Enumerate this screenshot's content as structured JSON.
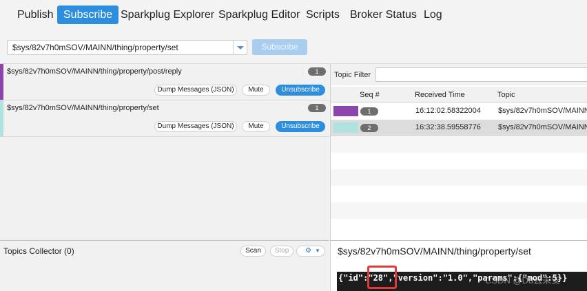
{
  "nav": {
    "items": [
      {
        "label": "Publish",
        "active": false
      },
      {
        "label": "Subscribe",
        "active": true
      },
      {
        "label": "Sparkplug Explorer",
        "active": false
      },
      {
        "label": "Sparkplug Editor",
        "active": false
      },
      {
        "label": "Scripts",
        "active": false
      },
      {
        "label": "Broker Status",
        "active": false
      },
      {
        "label": "Log",
        "active": false
      }
    ]
  },
  "subscribe_bar": {
    "topic_value": "$sys/82v7h0mSOV/MAINN/thing/property/set",
    "subscribe_label": "Subscribe"
  },
  "subscriptions": [
    {
      "topic": "$sys/82v7h0mSOV/MAINN/thing/property/post/reply",
      "count": "1",
      "color": "#8e44ad",
      "dump_label": "Dump Messages (JSON)",
      "mute_label": "Mute",
      "unsubscribe_label": "Unsubscribe"
    },
    {
      "topic": "$sys/82v7h0mSOV/MAINN/thing/property/set",
      "count": "1",
      "color": "#aee3df",
      "dump_label": "Dump Messages (JSON)",
      "mute_label": "Mute",
      "unsubscribe_label": "Unsubscribe"
    }
  ],
  "message_table": {
    "filter_label": "Topic Filter",
    "filter_value": "",
    "headers": {
      "seq": "Seq #",
      "received": "Received Time",
      "topic": "Topic"
    },
    "rows": [
      {
        "seq": "1",
        "time": "16:12:02.58322004",
        "topic": "$sys/82v7h0mSOV/MAINN",
        "color": "#8e44ad",
        "selected": false
      },
      {
        "seq": "2",
        "time": "16:32:38.59558776",
        "topic": "$sys/82v7h0mSOV/MAINN",
        "color": "#aee3df",
        "selected": true
      }
    ]
  },
  "topics_collector": {
    "label": "Topics Collector (0)",
    "scan_label": "Scan",
    "stop_label": "Stop"
  },
  "message_detail": {
    "topic": "$sys/82v7h0mSOV/MAINN/thing/property/set",
    "payload": "{\"id\":\"28\",\"version\":\"1.0\",\"params\":{\"mod\":5}}",
    "watermark": "CSDN @Dd云未安"
  }
}
